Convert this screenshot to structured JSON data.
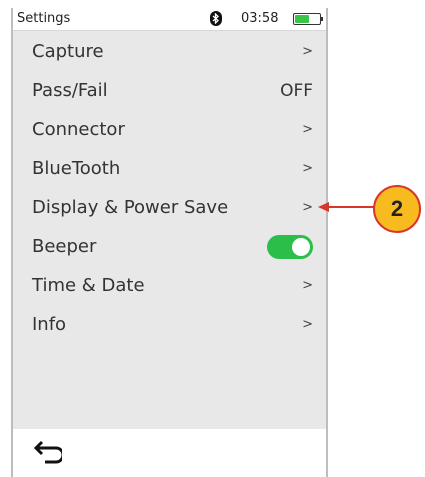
{
  "status_bar": {
    "title": "Settings",
    "bluetooth_icon": "bluetooth-icon",
    "time": "03:58",
    "battery_level": 0.6,
    "battery_color": "#39c54a"
  },
  "menu": {
    "items": [
      {
        "label": "Capture",
        "indicator": ">"
      },
      {
        "label": "Pass/Fail",
        "value": "OFF"
      },
      {
        "label": "Connector",
        "indicator": ">"
      },
      {
        "label": "BlueTooth",
        "indicator": ">"
      },
      {
        "label": "Display & Power Save",
        "indicator": ">"
      },
      {
        "label": "Beeper",
        "toggle_on": true,
        "toggle_color": "#2bbf4a"
      },
      {
        "label": "Time & Date",
        "indicator": ">"
      },
      {
        "label": "Info",
        "indicator": ">"
      }
    ]
  },
  "bottom_bar": {
    "back_icon": "back-arrow-icon"
  },
  "annotation": {
    "callout_number": "2",
    "callout_color": "#f7bb20",
    "arrow_color": "#d8362c"
  }
}
